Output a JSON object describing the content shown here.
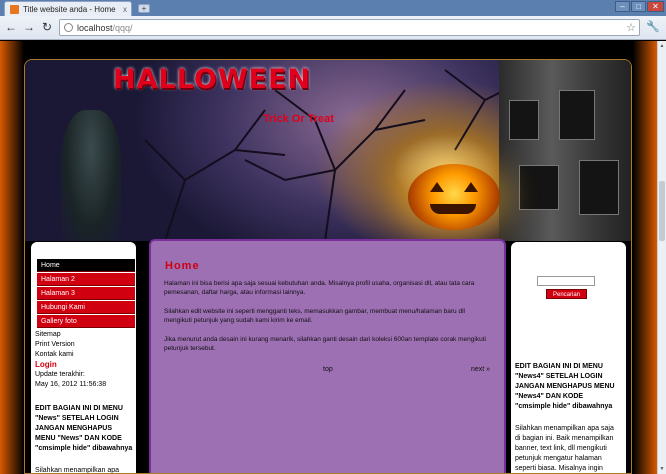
{
  "browser": {
    "tab_title": "Title website anda - Home",
    "tab_close": "x",
    "new_tab": "+",
    "url_host": "localhost",
    "url_path": "/qqq/"
  },
  "site": {
    "title": "HALLOWEEN",
    "slogan": "Trick Or Treat"
  },
  "menu": {
    "items": [
      "Home",
      "Halaman 2",
      "Halaman 3",
      "Hubungi Kami",
      "Gallery foto"
    ],
    "active_index": 0
  },
  "sidebar_left": {
    "links": [
      "Sitemap",
      "Print Version",
      "Kontak kami"
    ],
    "login": "Login",
    "last_update_label": "Update terakhir:",
    "last_update_value": "May 16, 2012 11:56:38",
    "news_heading": "EDIT BAGIAN INI DI MENU \"News\" SETELAH LOGIN JANGAN MENGHAPUS MENU \"News\" DAN KODE \"cmsimple hide\" dibawahnya",
    "news_text": "Silahkan menampilkan apa saja"
  },
  "main": {
    "heading": "Home",
    "paragraphs": [
      "Halaman ini bisa berisi apa saja sesuai kebutuhan anda. Misalnya profil usaha, organisasi dll, atau tata cara pemesanan, daftar harga, atau informasi lainnya.",
      "Silahkan edit website ini seperti mengganti teks, memasukkan gambar, membuat menu/halaman baru dll mengikuti petunjuk yang sudah kami kirim ke email.",
      "Jika menurut anda desain ini kurang menarik, silahkan ganti desain dari koleksi 600an template corak mengikuti petunjuk tersebut."
    ],
    "top_link": "top",
    "next_link": "next »"
  },
  "sidebar_right": {
    "search_button": "Pencarian",
    "news_heading": "EDIT BAGIAN INI DI MENU \"News4\" SETELAH LOGIN JANGAN MENGHAPUS MENU \"News4\" DAN KODE \"cmsimple hide\" dibawahnya",
    "news_text": "Silahkan menampilkan apa saja di bagian ini. Baik menampilkan banner, text link, dll mengikuti petunjuk mengatur halaman seperti biasa. Misalnya ingin menampilkan banner, hanya"
  },
  "colors": {
    "accent": "#d00010",
    "content_bg": "#9d6fb3",
    "page_edge": "#d85b00"
  }
}
